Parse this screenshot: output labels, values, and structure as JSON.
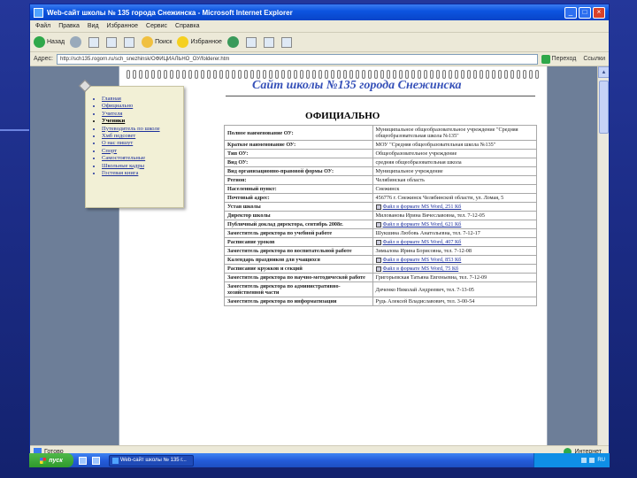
{
  "window": {
    "title": "Web-сайт школы № 135 города Снежинска - Microsoft Internet Explorer"
  },
  "menu": [
    "Файл",
    "Правка",
    "Вид",
    "Избранное",
    "Сервис",
    "Справка"
  ],
  "toolbar": {
    "back": "Назад",
    "search": "Поиск",
    "favorites": "Избранное"
  },
  "address": {
    "label": "Адрес:",
    "url": "http://sch135.rogorn.ru/sch_snezhinsk/ОФИЦИАЛЬНО_ОУ/folderer.htm",
    "go": "Переход",
    "links": "Ссылки"
  },
  "site": {
    "title": "Сайт школы №135 города Снежинска",
    "heading": "ОФИЦИАЛЬНО"
  },
  "nav": {
    "items": [
      "Главная",
      "Официально",
      "Учителя",
      "Ученики",
      "Путеводитель по школе",
      "Хмб педсовет",
      "О нас пишут",
      "Спорт",
      "Самостоятельные",
      "Школьные кадры",
      "Гостевая книга"
    ],
    "current": "Ученики"
  },
  "table": {
    "rows": [
      {
        "label": "Полное наименование ОУ:",
        "value": "Муниципальное общеобразовательное учреждение \"Средняя общеобразовательная школа №135\"",
        "link": false
      },
      {
        "label": "Краткое наименование ОУ:",
        "value": "МОУ \"Средняя общеобразовательная школа №135\"",
        "link": false
      },
      {
        "label": "Тип ОУ:",
        "value": "Общеобразовательное учреждение",
        "link": false
      },
      {
        "label": "Вид ОУ:",
        "value": "средняя общеобразовательная школа",
        "link": false
      },
      {
        "label": "Вид организационно-правовой формы ОУ:",
        "value": "Муниципальное учреждение",
        "link": false
      },
      {
        "label": "Регион:",
        "value": "Челябинская область",
        "link": false
      },
      {
        "label": "Населенный пункт:",
        "value": "Снежинск",
        "link": false
      },
      {
        "label": "Почтовый адрес:",
        "value": "456776 г. Снежинск Челябинской области, ул. Ломая, 5",
        "link": false
      },
      {
        "label": "Устав школы",
        "value": "Файл в формате MS Word, 251 Кб",
        "link": true
      },
      {
        "label": "Директор школы",
        "value": "Милованова Ирина Вячеславовна, тел. 7-12-05",
        "link": false
      },
      {
        "label": "Публичный доклад директора, сентябрь 2008г.",
        "value": "Файл в формате MS Word, 621 Кб",
        "link": true
      },
      {
        "label": "Заместитель директора по учебной работе",
        "value": "Шукшина Любовь Анатольевна, тел. 7-12-17",
        "link": false
      },
      {
        "label": "Расписание уроков",
        "value": "Файл в формате MS Word, 407 Кб",
        "link": true
      },
      {
        "label": "Заместитель директора по воспитательной работе",
        "value": "Зимылова Ирина Борисовна, тел. 7-12-08",
        "link": false
      },
      {
        "label": "Календарь праздников для учащихся",
        "value": "Файл в формате MS Word, 853 Кб",
        "link": true
      },
      {
        "label": "Расписание кружков и секций",
        "value": "Файл в формате MS Word, 75 Кб",
        "link": true
      },
      {
        "label": "Заместитель директора по научно-методической работе",
        "value": "Григорьевская Татьяна Евгеньевна, тел. 7-12-09",
        "link": false
      },
      {
        "label": "Заместитель директора по административно-хозяйственной части",
        "value": "Диченко Николай Андреевич, тел. 7-13-05",
        "link": false
      },
      {
        "label": "Заместитель директора по информатизации",
        "value": "Рудь Алексей Владиславович, тел. 3-00-54",
        "link": false
      }
    ]
  },
  "status": {
    "text": "Готово",
    "zone": "Интернет"
  },
  "taskbar": {
    "start": "пуск",
    "task": "Web-сайт школы № 135 г...",
    "time": "RU"
  }
}
